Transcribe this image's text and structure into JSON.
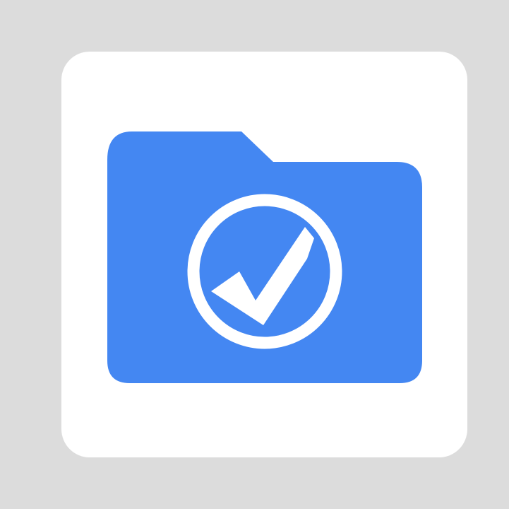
{
  "icon": {
    "name": "folder-check-icon",
    "tile_color": "#ffffff",
    "folder_color": "#4487f2",
    "badge_color": "#ffffff",
    "background_color": "#dcdcdc"
  }
}
